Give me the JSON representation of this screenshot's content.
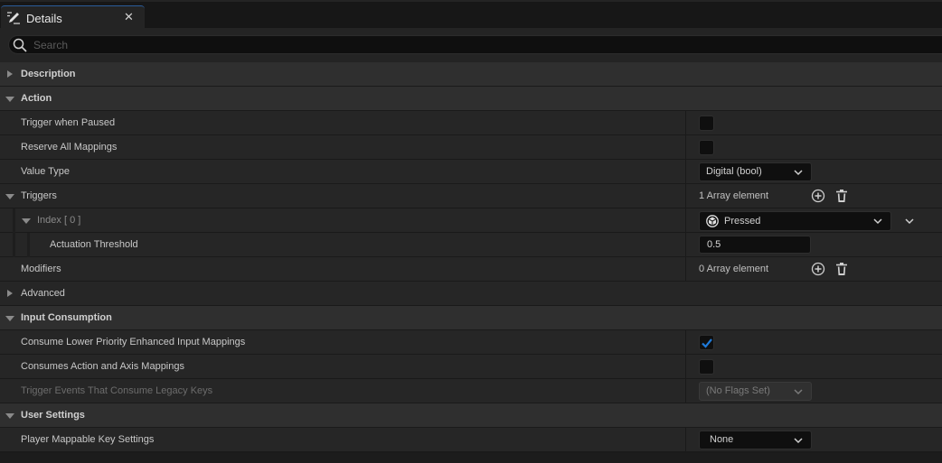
{
  "panel": {
    "tab_title": "Details",
    "tab_icon": "details-pencil-icon",
    "close_icon": "close-icon",
    "close_glyph": "✕"
  },
  "search": {
    "placeholder": "Search",
    "value": "",
    "icon": "search-icon"
  },
  "sections": {
    "description": {
      "label": "Description",
      "expanded": false
    },
    "action": {
      "label": "Action",
      "expanded": true
    },
    "advanced": {
      "label": "Advanced",
      "expanded": false
    },
    "input_consumption": {
      "label": "Input Consumption",
      "expanded": true
    },
    "user_settings": {
      "label": "User Settings",
      "expanded": true
    }
  },
  "properties": {
    "trigger_when_paused": {
      "label": "Trigger when Paused",
      "checked": false
    },
    "reserve_all_mappings": {
      "label": "Reserve All Mappings",
      "checked": false
    },
    "value_type": {
      "label": "Value Type",
      "value": "Digital (bool)"
    },
    "triggers": {
      "label": "Triggers",
      "count_text": "1 Array element",
      "add_icon": "add-circle-icon",
      "delete_icon": "trash-icon"
    },
    "index0": {
      "label": "Index [ 0 ]",
      "value": "Pressed",
      "icon": "pressed-trigger-icon"
    },
    "actuation_threshold": {
      "label": "Actuation Threshold",
      "value": "0.5"
    },
    "modifiers": {
      "label": "Modifiers",
      "count_text": "0 Array element"
    },
    "consume_lower_priority": {
      "label": "Consume Lower Priority Enhanced Input Mappings",
      "checked": true
    },
    "consumes_action_axis": {
      "label": "Consumes Action and Axis Mappings",
      "checked": false
    },
    "trigger_events_legacy": {
      "label": "Trigger Events That Consume Legacy Keys",
      "value": "(No Flags Set)",
      "disabled": true
    },
    "player_mappable_key_settings": {
      "label": "Player Mappable Key Settings",
      "value": "None"
    }
  },
  "colors": {
    "accent": "#2a5c9a",
    "check": "#1e7ad9",
    "panel_bg": "#262626",
    "category_bg": "#2f2f2f"
  }
}
